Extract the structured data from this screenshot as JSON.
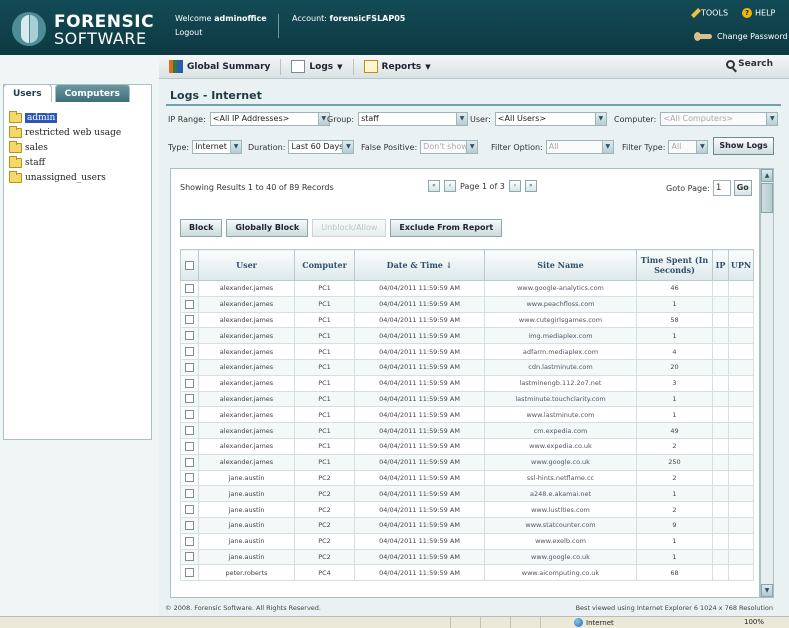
{
  "brand": {
    "line1": "FORENSIC",
    "line2": "SOFTWARE"
  },
  "header": {
    "welcome_prefix": "Welcome",
    "username": "adminoffice",
    "logout": "Logout",
    "account_prefix": "Account:",
    "account": "forensicFSLAP05",
    "tools": "TOOLS",
    "help": "HELP",
    "change_password": "Change Password"
  },
  "toolbar": {
    "global_summary": "Global Summary",
    "logs": "Logs",
    "reports": "Reports",
    "search": "Search"
  },
  "left": {
    "tabs": [
      "Users",
      "Computers"
    ],
    "tree": [
      "admin",
      "restricted web usage",
      "sales",
      "staff",
      "unassigned_users"
    ],
    "selected": 0
  },
  "page": {
    "title": "Logs - Internet"
  },
  "filters": {
    "ip_range_label": "IP Range:",
    "ip_range": "<All IP Addresses>",
    "group_label": "Group:",
    "group": "staff",
    "user_label": "User:",
    "user": "<All Users>",
    "computer_label": "Computer:",
    "computer": "<All Computers>",
    "type_label": "Type:",
    "type": "Internet",
    "duration_label": "Duration:",
    "duration": "Last 60 Days",
    "false_positive_label": "False Positive:",
    "false_positive": "Don't show",
    "filter_option_label": "Filter Option:",
    "filter_option": "All",
    "filter_type_label": "Filter Type:",
    "filter_type": "All",
    "show_logs": "Show Logs"
  },
  "results": {
    "showing": "Showing Results 1 to 40 of 89 Records",
    "page_info": "Page 1 of 3",
    "goto_label": "Goto Page:",
    "goto_value": "1",
    "go": "Go"
  },
  "actions": {
    "block": "Block",
    "globally_block": "Globally Block",
    "unblock": "Unblock/Allow",
    "exclude": "Exclude From Report"
  },
  "table": {
    "columns": [
      "User",
      "Computer",
      "Date & Time ↓",
      "Site Name",
      "Time Spent (In Seconds)",
      "IP",
      "UPN"
    ],
    "rows": [
      [
        "alexander.james",
        "PC1",
        "04/04/2011 11:59:59 AM",
        "www.google-analytics.com",
        "46"
      ],
      [
        "alexander.james",
        "PC1",
        "04/04/2011 11:59:59 AM",
        "www.peachfloss.com",
        "1"
      ],
      [
        "alexander.james",
        "PC1",
        "04/04/2011 11:59:59 AM",
        "www.cutegirlsgames.com",
        "58"
      ],
      [
        "alexander.james",
        "PC1",
        "04/04/2011 11:59:59 AM",
        "img.mediaplex.com",
        "1"
      ],
      [
        "alexander.james",
        "PC1",
        "04/04/2011 11:59:59 AM",
        "adfarm.mediaplex.com",
        "4"
      ],
      [
        "alexander.james",
        "PC1",
        "04/04/2011 11:59:59 AM",
        "cdn.lastminute.com",
        "20"
      ],
      [
        "alexander.james",
        "PC1",
        "04/04/2011 11:59:59 AM",
        "lastminengb.112.2o7.net",
        "3"
      ],
      [
        "alexander.james",
        "PC1",
        "04/04/2011 11:59:59 AM",
        "lastminute.touchclarity.com",
        "1"
      ],
      [
        "alexander.james",
        "PC1",
        "04/04/2011 11:59:59 AM",
        "www.lastminute.com",
        "1"
      ],
      [
        "alexander.james",
        "PC1",
        "04/04/2011 11:59:59 AM",
        "cm.expedia.com",
        "49"
      ],
      [
        "alexander.james",
        "PC1",
        "04/04/2011 11:59:59 AM",
        "www.expedia.co.uk",
        "2"
      ],
      [
        "alexander.james",
        "PC1",
        "04/04/2011 11:59:59 AM",
        "www.google.co.uk",
        "250"
      ],
      [
        "jane.austin",
        "PC2",
        "04/04/2011 11:59:59 AM",
        "ssl-hints.netflame.cc",
        "2"
      ],
      [
        "jane.austin",
        "PC2",
        "04/04/2011 11:59:59 AM",
        "a248.e.akamai.net",
        "1"
      ],
      [
        "jane.austin",
        "PC2",
        "04/04/2011 11:59:59 AM",
        "www.lustlties.com",
        "2"
      ],
      [
        "jane.austin",
        "PC2",
        "04/04/2011 11:59:59 AM",
        "www.statcounter.com",
        "9"
      ],
      [
        "jane.austin",
        "PC2",
        "04/04/2011 11:59:59 AM",
        "www.exelb.com",
        "1"
      ],
      [
        "jane.austin",
        "PC2",
        "04/04/2011 11:59:59 AM",
        "www.google.co.uk",
        "1"
      ],
      [
        "peter.roberts",
        "PC4",
        "04/04/2011 11:59:59 AM",
        "www.aicomputing.co.uk",
        "68"
      ]
    ]
  },
  "footer": {
    "copyright": "© 2008. Forensic Software. All Rights Reserved.",
    "best_viewed": "Best viewed using Internet Explorer 6 1024 x 768 Resolution"
  },
  "statusbar": {
    "zone": "Internet",
    "zoom": "100%"
  }
}
